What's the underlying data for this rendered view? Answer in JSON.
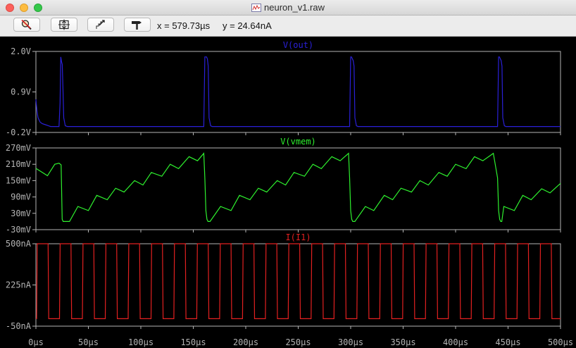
{
  "window": {
    "title": "neuron_v1.raw"
  },
  "toolbar": {
    "buttons": [
      {
        "name": "zoom-out-button",
        "icon": "magnifier-cross-icon"
      },
      {
        "name": "autoscale-button",
        "icon": "fit-frame-icon"
      },
      {
        "name": "zoom-previous-button",
        "icon": "undo-zoom-icon"
      },
      {
        "name": "pan-button",
        "icon": "hammer-icon"
      }
    ],
    "x_readout": "x = 579.73µs",
    "y_readout": "y = 24.64nA"
  },
  "colors": {
    "background": "#000000",
    "frame": "#b4b4b4",
    "vout": "#2a20d8",
    "vmem": "#2ef02e",
    "i1": "#e22020"
  },
  "chart_data": [
    {
      "type": "line",
      "title": "V(out)",
      "ylabel": "",
      "xlabel": "",
      "xlim": [
        0,
        500
      ],
      "ylim": [
        -0.2,
        2.0
      ],
      "yticks": [
        "2.0V",
        "0.9V",
        "-0.2V"
      ],
      "series": [
        {
          "name": "V(out)",
          "x": [
            0,
            1,
            2,
            4,
            6,
            8,
            10,
            12,
            14,
            22,
            23,
            23.7,
            24.4,
            25.1,
            25.8,
            26.5,
            28,
            30,
            160,
            161,
            161.8,
            162.6,
            163.4,
            164.2,
            165,
            166.5,
            168,
            299,
            300,
            300.8,
            301.6,
            302.4,
            303.2,
            304,
            305.5,
            307,
            440,
            441,
            441.8,
            442.6,
            443.4,
            444.2,
            445,
            446.5,
            448,
            500
          ],
          "y": [
            0.7,
            0.38,
            0.2,
            0.08,
            0.04,
            0.02,
            0.0,
            -0.02,
            -0.04,
            -0.04,
            0.6,
            1.85,
            1.72,
            1.65,
            1.0,
            0.2,
            -0.02,
            -0.04,
            -0.04,
            1.85,
            1.85,
            1.85,
            1.8,
            1.6,
            0.2,
            -0.02,
            -0.04,
            -0.04,
            1.85,
            1.85,
            1.8,
            1.75,
            1.6,
            0.2,
            -0.02,
            -0.04,
            -0.04,
            1.85,
            1.85,
            1.8,
            1.75,
            1.6,
            0.2,
            -0.02,
            -0.04,
            -0.04
          ]
        }
      ]
    },
    {
      "type": "line",
      "title": "V(vmem)",
      "ylabel": "",
      "xlabel": "",
      "xlim": [
        0,
        500
      ],
      "ylim": [
        -30,
        270
      ],
      "yticks": [
        "270mV",
        "210mV",
        "150mV",
        "90mV",
        "30mV",
        "-30mV"
      ],
      "series": [
        {
          "name": "V(vmem)",
          "x": [
            0,
            11,
            18,
            22,
            24,
            25,
            26,
            32,
            40,
            50,
            58,
            68,
            76,
            84,
            94,
            102,
            110,
            120,
            128,
            136,
            146,
            154,
            160,
            161,
            162,
            163,
            164,
            166,
            176,
            186,
            194,
            204,
            212,
            220,
            230,
            238,
            246,
            256,
            264,
            272,
            282,
            290,
            298,
            299,
            300,
            301,
            302,
            304,
            314,
            322,
            332,
            340,
            348,
            358,
            366,
            374,
            384,
            392,
            400,
            410,
            418,
            426,
            436,
            440,
            441,
            442,
            443,
            444,
            446,
            456,
            464,
            472,
            482,
            490,
            500
          ],
          "y": [
            195,
            168,
            210,
            214,
            208,
            8,
            0,
            0,
            55,
            40,
            96,
            80,
            122,
            108,
            150,
            134,
            180,
            166,
            210,
            194,
            238,
            223,
            250,
            160,
            40,
            8,
            0,
            0,
            55,
            40,
            96,
            80,
            122,
            108,
            150,
            134,
            180,
            166,
            210,
            194,
            238,
            223,
            250,
            160,
            40,
            8,
            0,
            0,
            55,
            40,
            96,
            80,
            122,
            108,
            150,
            134,
            180,
            166,
            210,
            194,
            238,
            223,
            250,
            160,
            40,
            8,
            0,
            0,
            55,
            40,
            96,
            80,
            120,
            105,
            140
          ]
        }
      ]
    },
    {
      "type": "line",
      "title": "I(I1)",
      "ylabel": "",
      "xlabel": "",
      "xlim": [
        0,
        500
      ],
      "ylim": [
        -50,
        500
      ],
      "yticks": [
        "500nA",
        "225nA",
        "-50nA"
      ],
      "xticks": [
        "0µs",
        "50µs",
        "100µs",
        "150µs",
        "200µs",
        "250µs",
        "300µs",
        "350µs",
        "400µs",
        "450µs",
        "500µs"
      ],
      "series": [
        {
          "name": "I(I1)",
          "square_wave": {
            "period": 21.8,
            "high": 500,
            "low": 0,
            "start": 0.7,
            "high_fraction": 0.5,
            "start_level": "low"
          }
        }
      ]
    }
  ]
}
